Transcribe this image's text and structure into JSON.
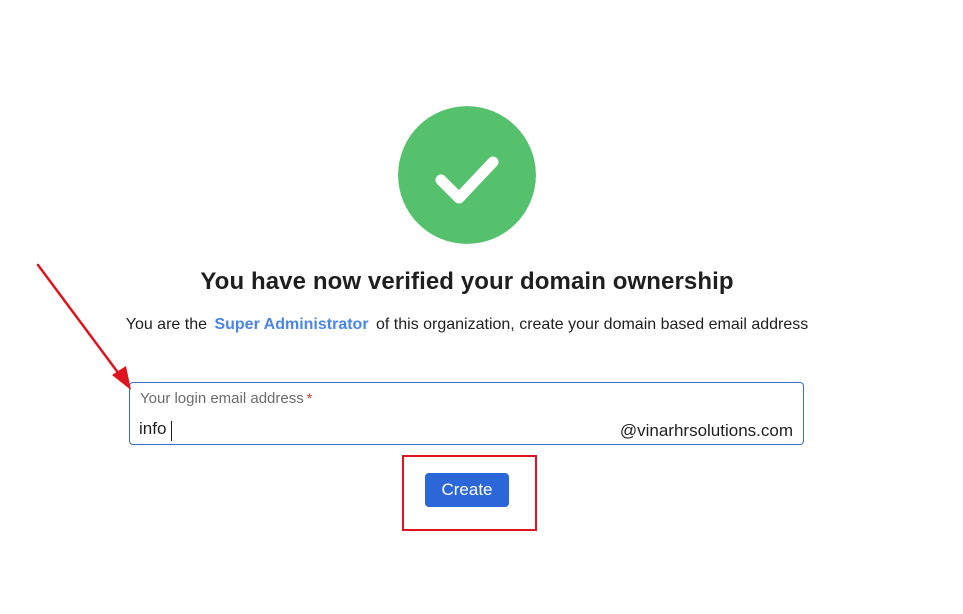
{
  "status": {
    "icon": "checkmark-circle-icon",
    "color": "#55c16c"
  },
  "headline": "You have now verified your domain ownership",
  "subline": {
    "prefix": "You are the",
    "role_link": "Super Administrator",
    "suffix": "of this organization, create your domain based email address"
  },
  "email_form": {
    "label": "Your login email address",
    "required_mark": "*",
    "value": "info",
    "domain_suffix": "@vinarhrsolutions.com"
  },
  "actions": {
    "create_label": "Create",
    "accent_color": "#2b67d9"
  },
  "annotations": {
    "arrow_icon": "red-arrow-icon",
    "highlight_color": "#e0141e"
  }
}
